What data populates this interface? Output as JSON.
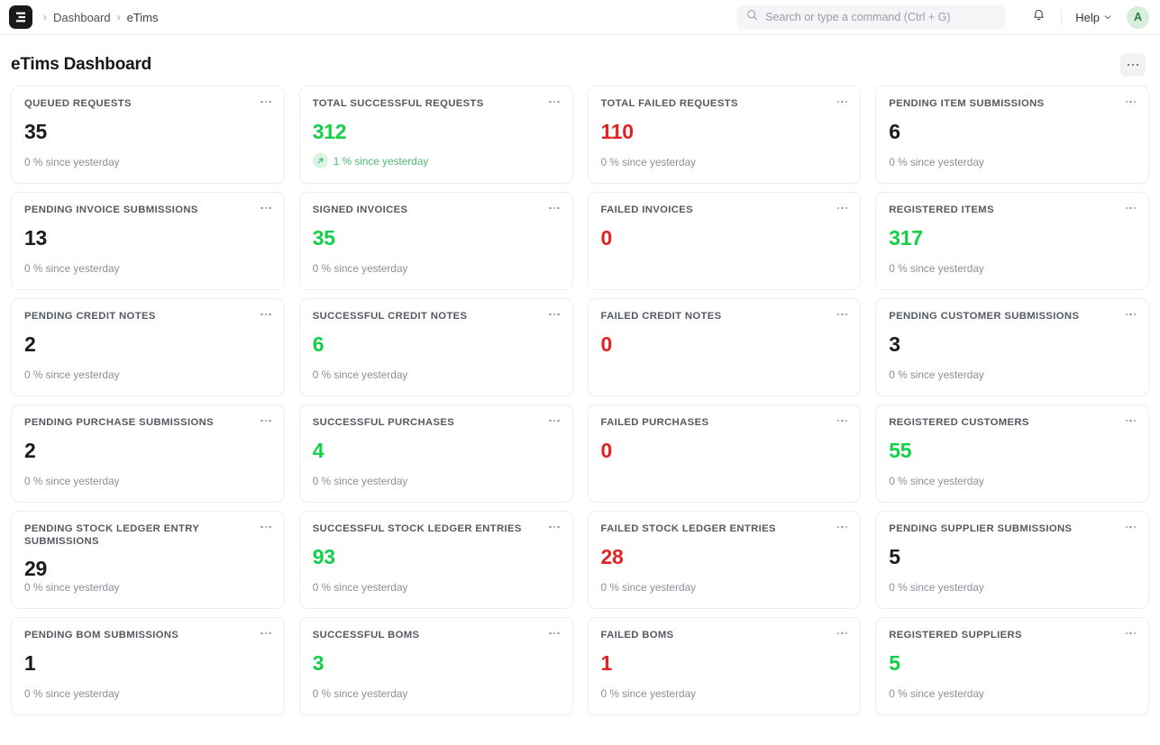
{
  "navbar": {
    "logo_icon": "etims-logo-icon",
    "breadcrumb": [
      {
        "label": "Dashboard"
      },
      {
        "label": "eTims"
      }
    ],
    "separator": "›",
    "search": {
      "icon": "search-icon",
      "placeholder": "Search or type a command (Ctrl + G)",
      "value": ""
    },
    "notifications_icon": "bell-icon",
    "help_label": "Help",
    "help_caret_icon": "chevron-down-icon",
    "avatar_initial": "A"
  },
  "page": {
    "title": "eTims Dashboard",
    "menu_icon": "ellipsis-icon"
  },
  "colors": {
    "green": "#14cf48",
    "red": "#e02424",
    "neutral": "#1b1b1b",
    "trend_up": "#4eb878",
    "trend_badge_bg": "#dbf3e3"
  },
  "cards": [
    {
      "label": "QUEUED REQUESTS",
      "value": "35",
      "tone": "neutral",
      "footer": "0 % since yesterday",
      "trend": null
    },
    {
      "label": "TOTAL SUCCESSFUL REQUESTS",
      "value": "312",
      "tone": "green",
      "footer": "1 % since yesterday",
      "trend": "up"
    },
    {
      "label": "TOTAL FAILED REQUESTS",
      "value": "110",
      "tone": "red",
      "footer": "0 % since yesterday",
      "trend": null
    },
    {
      "label": "PENDING ITEM SUBMISSIONS",
      "value": "6",
      "tone": "neutral",
      "footer": "0 % since yesterday",
      "trend": null
    },
    {
      "label": "PENDING INVOICE SUBMISSIONS",
      "value": "13",
      "tone": "neutral",
      "footer": "0 % since yesterday",
      "trend": null
    },
    {
      "label": "SIGNED INVOICES",
      "value": "35",
      "tone": "green",
      "footer": "0 % since yesterday",
      "trend": null
    },
    {
      "label": "FAILED INVOICES",
      "value": "0",
      "tone": "red",
      "footer": "",
      "trend": null
    },
    {
      "label": "REGISTERED ITEMS",
      "value": "317",
      "tone": "green",
      "footer": "0 % since yesterday",
      "trend": null
    },
    {
      "label": "PENDING CREDIT NOTES",
      "value": "2",
      "tone": "neutral",
      "footer": "0 % since yesterday",
      "trend": null
    },
    {
      "label": "SUCCESSFUL CREDIT NOTES",
      "value": "6",
      "tone": "green",
      "footer": "0 % since yesterday",
      "trend": null
    },
    {
      "label": "FAILED CREDIT NOTES",
      "value": "0",
      "tone": "red",
      "footer": "",
      "trend": null
    },
    {
      "label": "PENDING CUSTOMER SUBMISSIONS",
      "value": "3",
      "tone": "neutral",
      "footer": "0 % since yesterday",
      "trend": null
    },
    {
      "label": "PENDING PURCHASE SUBMISSIONS",
      "value": "2",
      "tone": "neutral",
      "footer": "0 % since yesterday",
      "trend": null
    },
    {
      "label": "SUCCESSFUL PURCHASES",
      "value": "4",
      "tone": "green",
      "footer": "0 % since yesterday",
      "trend": null
    },
    {
      "label": "FAILED PURCHASES",
      "value": "0",
      "tone": "red",
      "footer": "",
      "trend": null
    },
    {
      "label": "REGISTERED CUSTOMERS",
      "value": "55",
      "tone": "green",
      "footer": "0 % since yesterday",
      "trend": null
    },
    {
      "label": "PENDING STOCK LEDGER ENTRY SUBMISSIONS",
      "value": "29",
      "tone": "neutral",
      "footer": "0 % since yesterday",
      "trend": null
    },
    {
      "label": "SUCCESSFUL STOCK LEDGER ENTRIES",
      "value": "93",
      "tone": "green",
      "footer": "0 % since yesterday",
      "trend": null
    },
    {
      "label": "FAILED STOCK LEDGER ENTRIES",
      "value": "28",
      "tone": "red",
      "footer": "0 % since yesterday",
      "trend": null
    },
    {
      "label": "PENDING SUPPLIER SUBMISSIONS",
      "value": "5",
      "tone": "neutral",
      "footer": "0 % since yesterday",
      "trend": null
    },
    {
      "label": "PENDING BOM SUBMISSIONS",
      "value": "1",
      "tone": "neutral",
      "footer": "0 % since yesterday",
      "trend": null
    },
    {
      "label": "SUCCESSFUL BOMS",
      "value": "3",
      "tone": "green",
      "footer": "0 % since yesterday",
      "trend": null
    },
    {
      "label": "FAILED BOMS",
      "value": "1",
      "tone": "red",
      "footer": "0 % since yesterday",
      "trend": null
    },
    {
      "label": "REGISTERED SUPPLIERS",
      "value": "5",
      "tone": "green",
      "footer": "0 % since yesterday",
      "trend": null
    }
  ]
}
